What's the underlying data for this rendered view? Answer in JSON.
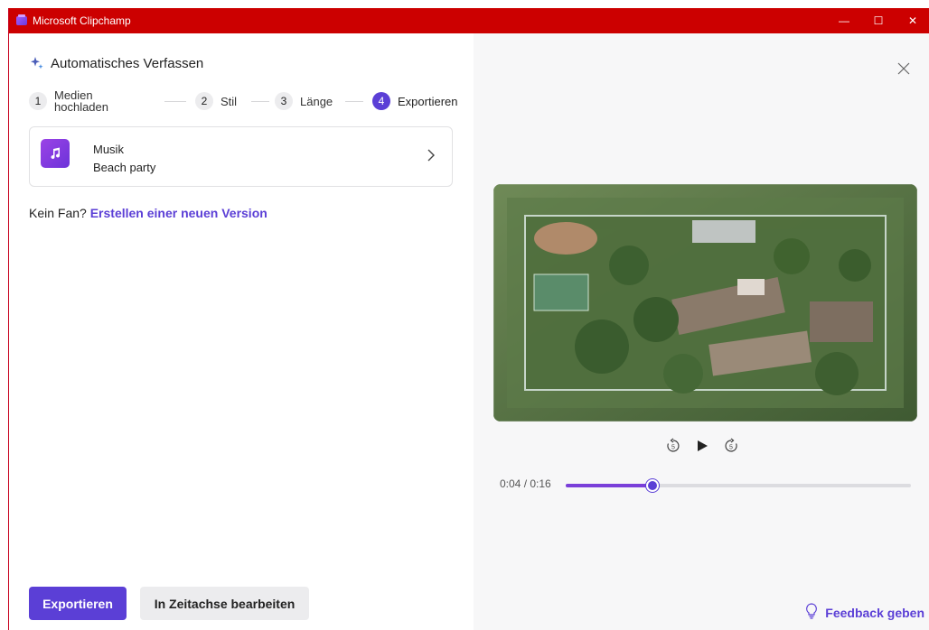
{
  "window": {
    "title": "Microsoft Clipchamp",
    "controls": {
      "minimize": "—",
      "maximize": "☐",
      "close": "✕"
    }
  },
  "header": {
    "icon": "sparkle-icon",
    "title": "Automatisches Verfassen"
  },
  "stepper": {
    "steps": [
      {
        "num": "1",
        "label_line1": "Medien",
        "label_line2": "hochladen"
      },
      {
        "num": "2",
        "label": "Stil"
      },
      {
        "num": "3",
        "label": "Länge"
      },
      {
        "num": "4",
        "label": "Exportieren",
        "active": true
      }
    ]
  },
  "music": {
    "icon": "music-note-icon",
    "type": "Musik",
    "name": "Beach party"
  },
  "regenerate": {
    "prefix": "Kein Fan?",
    "link": "Erstellen einer neuen Version"
  },
  "buttons": {
    "export": "Exportieren",
    "edit_timeline": "In Zeitachse bearbeiten"
  },
  "player": {
    "time": "0:04 / 0:16",
    "progress": 0.25,
    "rewind_label": "5",
    "forward_label": "5"
  },
  "feedback": {
    "label": "Feedback geben"
  },
  "colors": {
    "accent": "#5b3fd6",
    "titlebar": "#cc0000"
  }
}
